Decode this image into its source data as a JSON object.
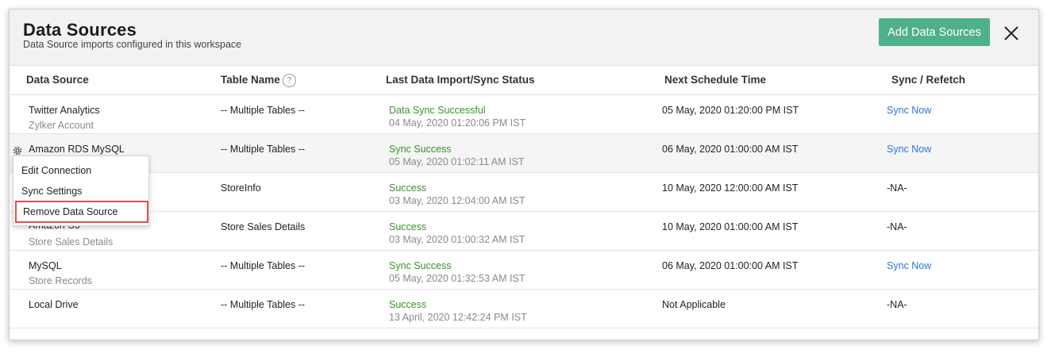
{
  "header": {
    "title": "Data Sources",
    "subtitle": "Data Source imports configured in this workspace",
    "add_button": "Add Data Sources",
    "close_icon": "close-icon"
  },
  "columns": {
    "data_source": "Data Source",
    "table_name": "Table Name",
    "help_icon": "?",
    "last_status": "Last Data Import/Sync Status",
    "next_schedule": "Next Schedule Time",
    "sync": "Sync / Refetch"
  },
  "rows": [
    {
      "name": "Twitter Analytics",
      "account": "Zylker Account",
      "table": "-- Multiple Tables --",
      "status": "Data Sync Successful",
      "status_date": "04 May, 2020 01:20:06 PM IST",
      "next": "05 May, 2020 01:20:00 PM IST",
      "sync": "Sync Now"
    },
    {
      "name": "Amazon RDS MySQL",
      "account": "",
      "table": "-- Multiple Tables --",
      "status": "Sync Success",
      "status_date": "05 May, 2020 01:02:11 AM IST",
      "next": "06 May, 2020 01:00:00 AM IST",
      "sync": "Sync Now"
    },
    {
      "name": "",
      "account": "",
      "table": "StoreInfo",
      "status": "Success",
      "status_date": "03 May, 2020 12:04:00 AM IST",
      "next": "10 May, 2020 12:00:00 AM IST",
      "sync": "-NA-"
    },
    {
      "name": "Amazon S3",
      "account": "Store Sales Details",
      "table": "Store Sales Details",
      "status": "Success",
      "status_date": "03 May, 2020 01:00:32 AM IST",
      "next": "10 May, 2020 01:00:00 AM IST",
      "sync": "-NA-"
    },
    {
      "name": "MySQL",
      "account": "Store Records",
      "table": "-- Multiple Tables --",
      "status": "Sync Success",
      "status_date": "05 May, 2020 01:32:53 AM IST",
      "next": "06 May, 2020 01:00:00 AM IST",
      "sync": "Sync Now"
    },
    {
      "name": "Local Drive",
      "account": "",
      "table": "-- Multiple Tables --",
      "status": "Success",
      "status_date": "13 April, 2020 12:42:24 PM IST",
      "next": "Not Applicable",
      "sync": "-NA-"
    }
  ],
  "context_menu": {
    "items": [
      "Edit Connection",
      "Sync Settings",
      "Remove Data Source"
    ]
  },
  "colors": {
    "accent": "#4fb18c",
    "success": "#3c8f2e",
    "link": "#2f73d6",
    "highlight": "#e2504c"
  }
}
